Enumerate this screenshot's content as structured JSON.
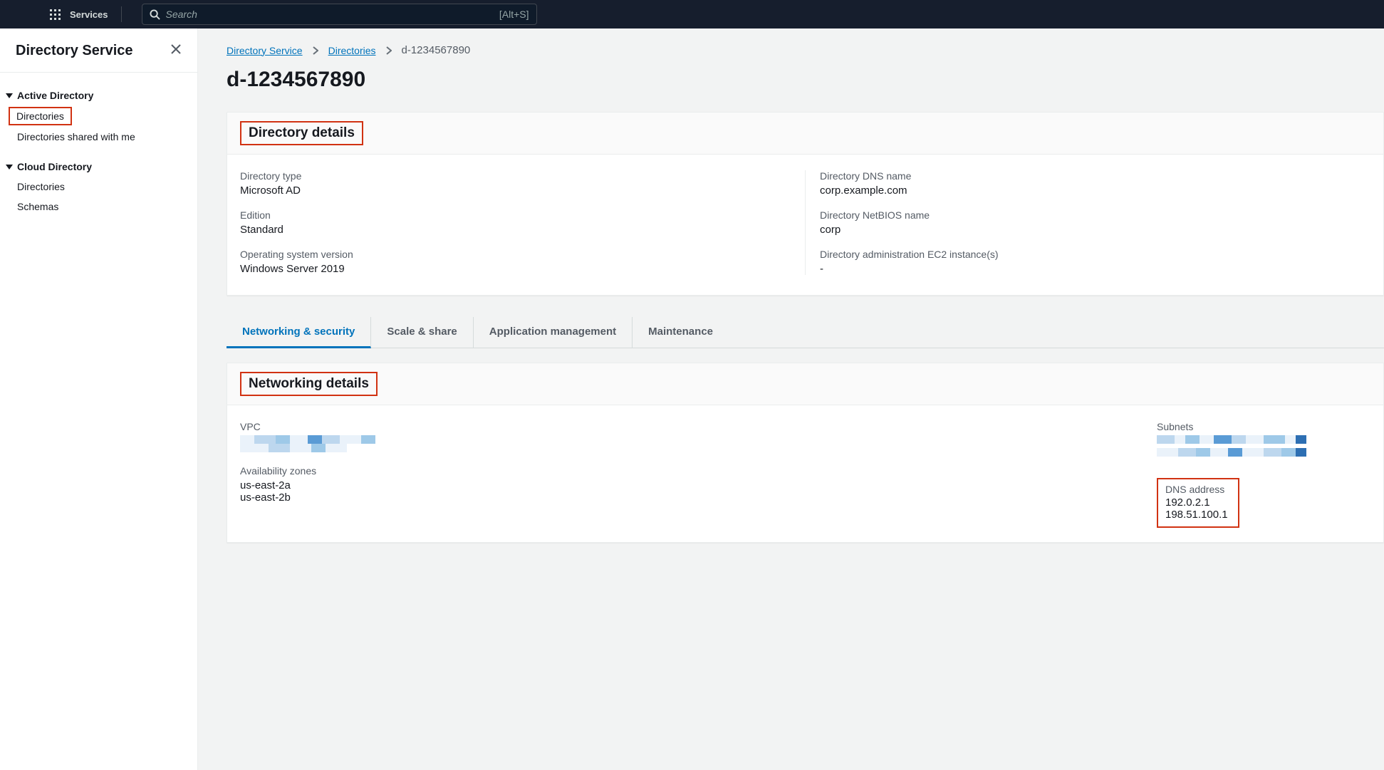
{
  "topnav": {
    "services_label": "Services",
    "search_placeholder": "Search",
    "search_hint": "[Alt+S]"
  },
  "sidebar": {
    "title": "Directory Service",
    "groups": [
      {
        "label": "Active Directory",
        "items": [
          {
            "label": "Directories",
            "highlight": true
          },
          {
            "label": "Directories shared with me",
            "highlight": false
          }
        ]
      },
      {
        "label": "Cloud Directory",
        "items": [
          {
            "label": "Directories",
            "highlight": false
          },
          {
            "label": "Schemas",
            "highlight": false
          }
        ]
      }
    ]
  },
  "breadcrumbs": {
    "items": [
      {
        "label": "Directory Service",
        "link": true
      },
      {
        "label": "Directories",
        "link": true
      },
      {
        "label": "d-1234567890",
        "link": false
      }
    ]
  },
  "page_title": "d-1234567890",
  "directory_details": {
    "panel_title": "Directory details",
    "left": [
      {
        "label": "Directory type",
        "value": "Microsoft AD"
      },
      {
        "label": "Edition",
        "value": "Standard"
      },
      {
        "label": "Operating system version",
        "value": "Windows Server 2019"
      }
    ],
    "right": [
      {
        "label": "Directory DNS name",
        "value": "corp.example.com"
      },
      {
        "label": "Directory NetBIOS name",
        "value": "corp"
      },
      {
        "label": "Directory administration EC2 instance(s)",
        "value": "-"
      }
    ]
  },
  "tabs": [
    {
      "label": "Networking & security",
      "active": true
    },
    {
      "label": "Scale & share",
      "active": false
    },
    {
      "label": "Application management",
      "active": false
    },
    {
      "label": "Maintenance",
      "active": false
    }
  ],
  "networking_details": {
    "panel_title": "Networking details",
    "vpc_label": "VPC",
    "az_label": "Availability zones",
    "az_values": [
      "us-east-2a",
      "us-east-2b"
    ],
    "subnets_label": "Subnets",
    "dns_label": "DNS address",
    "dns_values": [
      "192.0.2.1",
      "198.51.100.1"
    ]
  }
}
